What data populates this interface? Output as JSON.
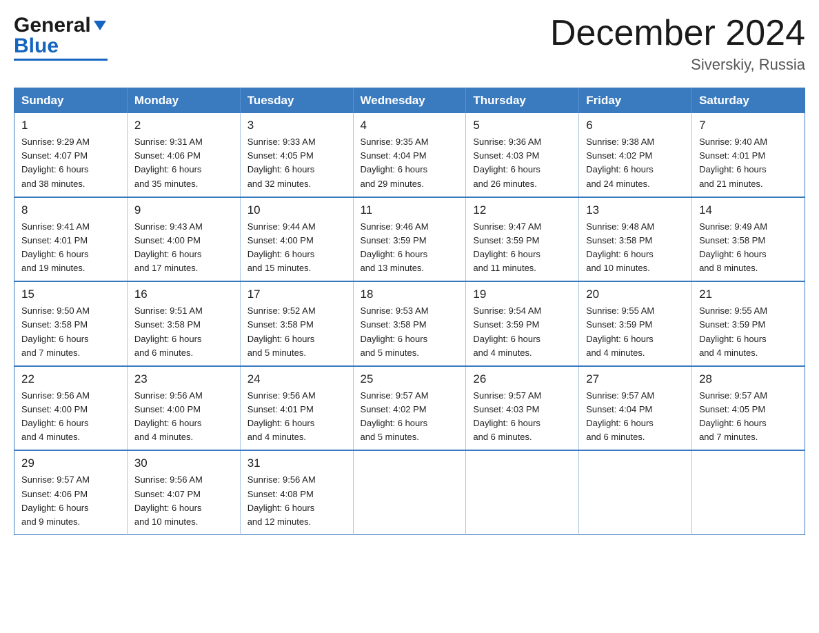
{
  "header": {
    "logo_line1": "General",
    "logo_line2": "Blue",
    "month": "December 2024",
    "location": "Siverskiy, Russia"
  },
  "weekdays": [
    "Sunday",
    "Monday",
    "Tuesday",
    "Wednesday",
    "Thursday",
    "Friday",
    "Saturday"
  ],
  "weeks": [
    [
      {
        "day": "1",
        "info": "Sunrise: 9:29 AM\nSunset: 4:07 PM\nDaylight: 6 hours\nand 38 minutes."
      },
      {
        "day": "2",
        "info": "Sunrise: 9:31 AM\nSunset: 4:06 PM\nDaylight: 6 hours\nand 35 minutes."
      },
      {
        "day": "3",
        "info": "Sunrise: 9:33 AM\nSunset: 4:05 PM\nDaylight: 6 hours\nand 32 minutes."
      },
      {
        "day": "4",
        "info": "Sunrise: 9:35 AM\nSunset: 4:04 PM\nDaylight: 6 hours\nand 29 minutes."
      },
      {
        "day": "5",
        "info": "Sunrise: 9:36 AM\nSunset: 4:03 PM\nDaylight: 6 hours\nand 26 minutes."
      },
      {
        "day": "6",
        "info": "Sunrise: 9:38 AM\nSunset: 4:02 PM\nDaylight: 6 hours\nand 24 minutes."
      },
      {
        "day": "7",
        "info": "Sunrise: 9:40 AM\nSunset: 4:01 PM\nDaylight: 6 hours\nand 21 minutes."
      }
    ],
    [
      {
        "day": "8",
        "info": "Sunrise: 9:41 AM\nSunset: 4:01 PM\nDaylight: 6 hours\nand 19 minutes."
      },
      {
        "day": "9",
        "info": "Sunrise: 9:43 AM\nSunset: 4:00 PM\nDaylight: 6 hours\nand 17 minutes."
      },
      {
        "day": "10",
        "info": "Sunrise: 9:44 AM\nSunset: 4:00 PM\nDaylight: 6 hours\nand 15 minutes."
      },
      {
        "day": "11",
        "info": "Sunrise: 9:46 AM\nSunset: 3:59 PM\nDaylight: 6 hours\nand 13 minutes."
      },
      {
        "day": "12",
        "info": "Sunrise: 9:47 AM\nSunset: 3:59 PM\nDaylight: 6 hours\nand 11 minutes."
      },
      {
        "day": "13",
        "info": "Sunrise: 9:48 AM\nSunset: 3:58 PM\nDaylight: 6 hours\nand 10 minutes."
      },
      {
        "day": "14",
        "info": "Sunrise: 9:49 AM\nSunset: 3:58 PM\nDaylight: 6 hours\nand 8 minutes."
      }
    ],
    [
      {
        "day": "15",
        "info": "Sunrise: 9:50 AM\nSunset: 3:58 PM\nDaylight: 6 hours\nand 7 minutes."
      },
      {
        "day": "16",
        "info": "Sunrise: 9:51 AM\nSunset: 3:58 PM\nDaylight: 6 hours\nand 6 minutes."
      },
      {
        "day": "17",
        "info": "Sunrise: 9:52 AM\nSunset: 3:58 PM\nDaylight: 6 hours\nand 5 minutes."
      },
      {
        "day": "18",
        "info": "Sunrise: 9:53 AM\nSunset: 3:58 PM\nDaylight: 6 hours\nand 5 minutes."
      },
      {
        "day": "19",
        "info": "Sunrise: 9:54 AM\nSunset: 3:59 PM\nDaylight: 6 hours\nand 4 minutes."
      },
      {
        "day": "20",
        "info": "Sunrise: 9:55 AM\nSunset: 3:59 PM\nDaylight: 6 hours\nand 4 minutes."
      },
      {
        "day": "21",
        "info": "Sunrise: 9:55 AM\nSunset: 3:59 PM\nDaylight: 6 hours\nand 4 minutes."
      }
    ],
    [
      {
        "day": "22",
        "info": "Sunrise: 9:56 AM\nSunset: 4:00 PM\nDaylight: 6 hours\nand 4 minutes."
      },
      {
        "day": "23",
        "info": "Sunrise: 9:56 AM\nSunset: 4:00 PM\nDaylight: 6 hours\nand 4 minutes."
      },
      {
        "day": "24",
        "info": "Sunrise: 9:56 AM\nSunset: 4:01 PM\nDaylight: 6 hours\nand 4 minutes."
      },
      {
        "day": "25",
        "info": "Sunrise: 9:57 AM\nSunset: 4:02 PM\nDaylight: 6 hours\nand 5 minutes."
      },
      {
        "day": "26",
        "info": "Sunrise: 9:57 AM\nSunset: 4:03 PM\nDaylight: 6 hours\nand 6 minutes."
      },
      {
        "day": "27",
        "info": "Sunrise: 9:57 AM\nSunset: 4:04 PM\nDaylight: 6 hours\nand 6 minutes."
      },
      {
        "day": "28",
        "info": "Sunrise: 9:57 AM\nSunset: 4:05 PM\nDaylight: 6 hours\nand 7 minutes."
      }
    ],
    [
      {
        "day": "29",
        "info": "Sunrise: 9:57 AM\nSunset: 4:06 PM\nDaylight: 6 hours\nand 9 minutes."
      },
      {
        "day": "30",
        "info": "Sunrise: 9:56 AM\nSunset: 4:07 PM\nDaylight: 6 hours\nand 10 minutes."
      },
      {
        "day": "31",
        "info": "Sunrise: 9:56 AM\nSunset: 4:08 PM\nDaylight: 6 hours\nand 12 minutes."
      },
      {
        "day": "",
        "info": ""
      },
      {
        "day": "",
        "info": ""
      },
      {
        "day": "",
        "info": ""
      },
      {
        "day": "",
        "info": ""
      }
    ]
  ]
}
